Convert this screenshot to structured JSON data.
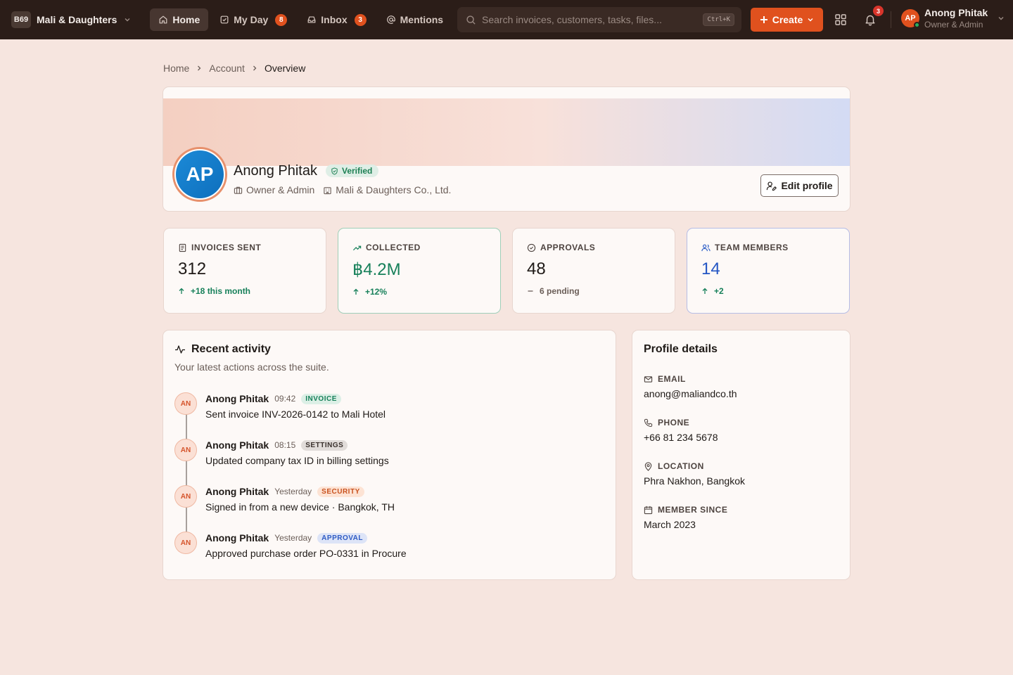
{
  "topbar": {
    "brand_logo": "B69",
    "brand_name": "Mali & Daughters",
    "nav": [
      {
        "label": "Home",
        "icon": "home-icon",
        "active": true
      },
      {
        "label": "My Day",
        "icon": "check-square-icon",
        "badge": "8"
      },
      {
        "label": "Inbox",
        "icon": "inbox-icon",
        "badge": "3"
      },
      {
        "label": "Mentions",
        "icon": "at-icon"
      }
    ],
    "search_placeholder": "Search invoices, customers, tasks, files...",
    "search_shortcut": "Ctrl+K",
    "create_label": "Create",
    "notifications_count": "3",
    "user": {
      "initials": "AP",
      "name": "Anong Phitak",
      "role": "Owner & Admin"
    }
  },
  "breadcrumb": [
    "Home",
    "Account",
    "Overview"
  ],
  "profile": {
    "initials": "AP",
    "name": "Anong Phitak",
    "verified_label": "Verified",
    "role": "Owner & Admin",
    "company": "Mali & Daughters Co., Ltd.",
    "edit_label": "Edit profile"
  },
  "stats": [
    {
      "label": "INVOICES SENT",
      "icon": "document-icon",
      "value": "312",
      "delta": "+18 this month",
      "trend": "up"
    },
    {
      "label": "COLLECTED",
      "icon": "trend-up-icon",
      "value": "฿4.2M",
      "delta": "+12%",
      "trend": "up"
    },
    {
      "label": "APPROVALS",
      "icon": "check-circle-icon",
      "value": "48",
      "delta": "6 pending",
      "trend": "flat"
    },
    {
      "label": "TEAM MEMBERS",
      "icon": "users-icon",
      "value": "14",
      "delta": "+2",
      "trend": "up"
    }
  ],
  "activity": {
    "title": "Recent activity",
    "subtitle": "Your latest actions across the suite.",
    "items": [
      {
        "initials": "AN",
        "name": "Anong Phitak",
        "time": "09:42",
        "tag": "INVOICE",
        "text": "Sent invoice INV-2026-0142 to Mali Hotel"
      },
      {
        "initials": "AN",
        "name": "Anong Phitak",
        "time": "08:15",
        "tag": "SETTINGS",
        "text": "Updated company tax ID in billing settings"
      },
      {
        "initials": "AN",
        "name": "Anong Phitak",
        "time": "Yesterday",
        "tag": "SECURITY",
        "text": "Signed in from a new device · Bangkok, TH"
      },
      {
        "initials": "AN",
        "name": "Anong Phitak",
        "time": "Yesterday",
        "tag": "APPROVAL",
        "text": "Approved purchase order PO-0331 in Procure"
      }
    ]
  },
  "details": {
    "title": "Profile details",
    "fields": [
      {
        "label": "EMAIL",
        "icon": "mail-icon",
        "value": "anong@maliandco.th"
      },
      {
        "label": "PHONE",
        "icon": "phone-icon",
        "value": "+66 81 234 5678"
      },
      {
        "label": "LOCATION",
        "icon": "map-pin-icon",
        "value": "Phra Nakhon, Bangkok"
      },
      {
        "label": "MEMBER SINCE",
        "icon": "calendar-icon",
        "value": "March 2023"
      }
    ]
  },
  "colors": {
    "accent": "#e0511e",
    "topbar": "#2b1d18",
    "background": "#f6e5df",
    "positive": "#17805a",
    "info": "#2456c4"
  }
}
